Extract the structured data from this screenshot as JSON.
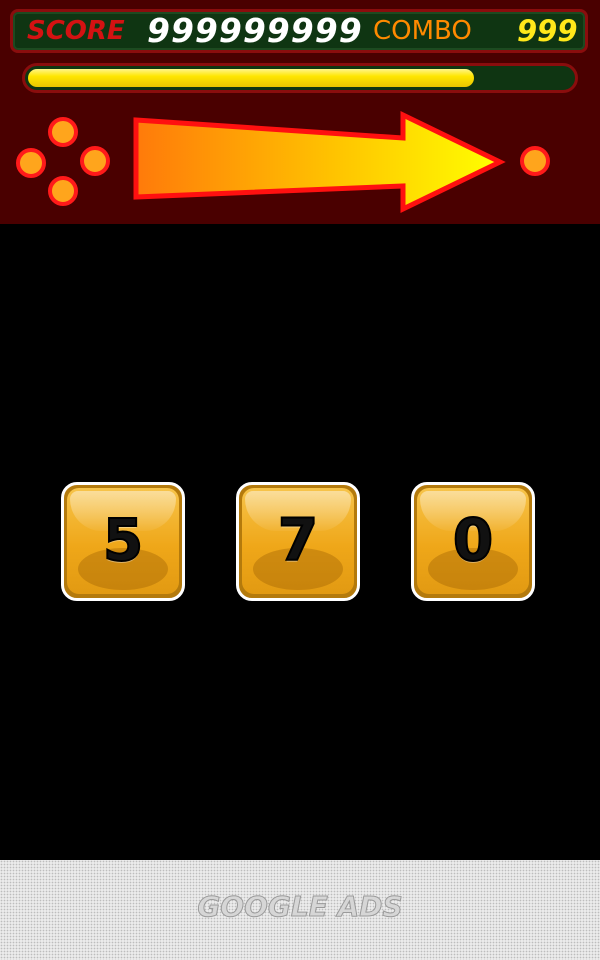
{
  "hud": {
    "score_label": "SCORE",
    "score_value": "999999999",
    "combo_label": "COMBO",
    "combo_value": "999",
    "progress_fraction": 0.82
  },
  "direction": "right",
  "tiles": [
    {
      "value": "5"
    },
    {
      "value": "7"
    },
    {
      "value": "0"
    }
  ],
  "ads": {
    "label": "GOOGLE ADS"
  },
  "colors": {
    "hud_background": "#4a0000",
    "panel": "#0f3512",
    "border": "#8a0d0d",
    "score_label": "#d41212",
    "combo_label": "#ff8a00",
    "combo_value": "#ffe81a",
    "tile": "#efa719"
  }
}
